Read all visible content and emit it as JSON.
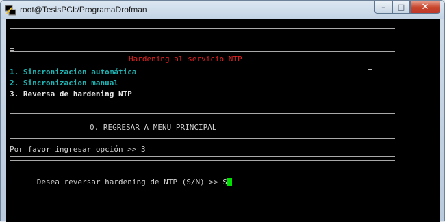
{
  "window": {
    "title": "root@TesisPCI:/ProgramaDrofman",
    "icon": "putty-terminal-icon",
    "controls": {
      "minimize": "–",
      "maximize": "□",
      "close": "✕"
    }
  },
  "terminal": {
    "header_side_char": "=",
    "header_title": "Hardening al servicio NTP",
    "menu": [
      {
        "text": "1. Sincronizacion automática"
      },
      {
        "text": "2. Sincronizacion manual"
      },
      {
        "text": "3. Reversa de hardening NTP"
      }
    ],
    "return_option": "0. REGRESAR A MENU PRINCIPAL",
    "prompt_option": "Por favor ingresar opción >> 3",
    "prompt_confirm": "Desea reversar hardening de NTP (S/N) >> S"
  },
  "colors": {
    "title_red": "#e02020",
    "menu_cyan": "#1fb3b3",
    "cursor_green": "#00e000",
    "terminal_bg": "#000000"
  }
}
